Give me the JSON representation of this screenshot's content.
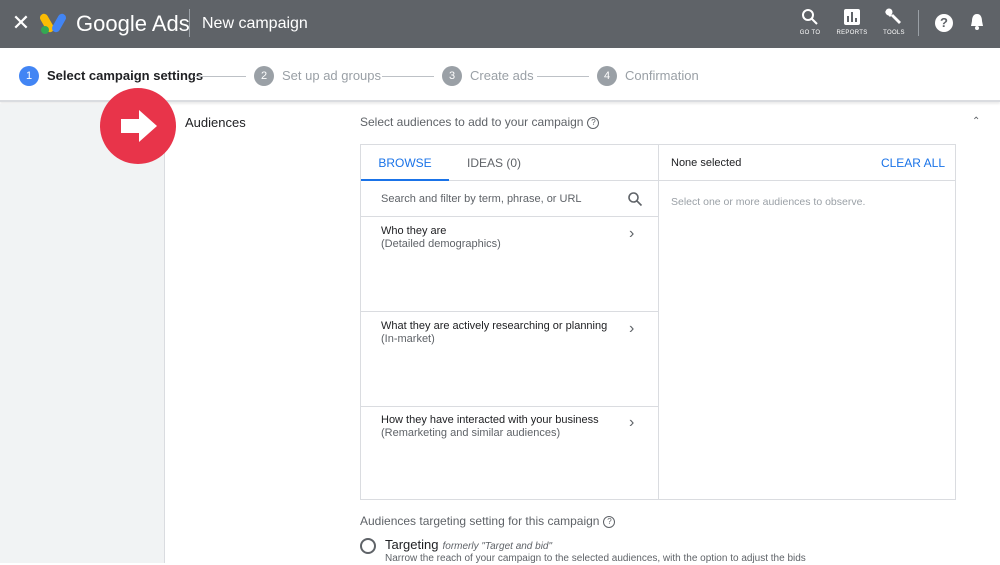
{
  "topbar": {
    "close_icon": "close-icon",
    "brand": "Google Ads",
    "title": "New campaign",
    "tools": [
      {
        "label": "GO TO",
        "icon": "search-icon"
      },
      {
        "label": "REPORTS",
        "icon": "bar-chart-icon"
      },
      {
        "label": "TOOLS",
        "icon": "wrench-icon"
      }
    ],
    "help": "?"
  },
  "stepper": {
    "steps": [
      {
        "num": "1",
        "label": "Select campaign settings",
        "state": "active"
      },
      {
        "num": "2",
        "label": "Set up ad groups",
        "state": "inactive"
      },
      {
        "num": "3",
        "label": "Create ads",
        "state": "inactive"
      },
      {
        "num": "4",
        "label": "Confirmation",
        "state": "inactive"
      }
    ]
  },
  "section": {
    "label": "Audiences",
    "instruction": "Select audiences to add to your campaign"
  },
  "browser": {
    "tabs": {
      "browse": "BROWSE",
      "ideas": "IDEAS",
      "ideas_count": "(0)"
    },
    "search_placeholder": "Search and filter by term, phrase, or URL",
    "categories": [
      {
        "title": "Who they are",
        "subtitle": "(Detailed demographics)"
      },
      {
        "title": "What they are actively researching or planning",
        "subtitle": "(In-market)"
      },
      {
        "title": "How they have interacted with your business",
        "subtitle": "(Remarketing and similar audiences)"
      }
    ]
  },
  "selection": {
    "status": "None selected",
    "clear_all": "CLEAR ALL",
    "hint": "Select one or more audiences to observe."
  },
  "targeting": {
    "title": "Audiences targeting setting for this campaign",
    "option_label": "Targeting",
    "option_note": "formerly \"Target and bid\"",
    "option_desc": "Narrow the reach of your campaign to the selected audiences, with the option to adjust the bids"
  },
  "colors": {
    "topbar": "#5f6368",
    "accent": "#1a73e8",
    "step_active": "#4285f4",
    "badge": "#e8344a"
  }
}
